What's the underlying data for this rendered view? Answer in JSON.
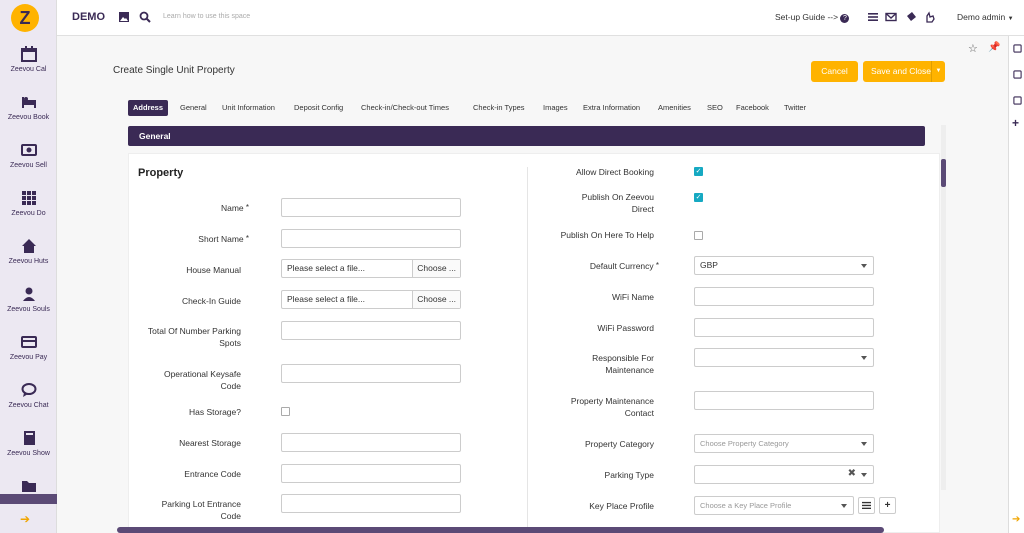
{
  "sidebar": {
    "logo": "Z",
    "items": [
      {
        "label": "Zeevou Cal",
        "icon": "calendar-icon"
      },
      {
        "label": "Zeevou Book",
        "icon": "bed-icon"
      },
      {
        "label": "Zeevou Sell",
        "icon": "money-icon"
      },
      {
        "label": "Zeevou Do",
        "icon": "grid-icon"
      },
      {
        "label": "Zeevou Huts",
        "icon": "home-icon"
      },
      {
        "label": "Zeevou Souls",
        "icon": "user-icon"
      },
      {
        "label": "Zeevou Pay",
        "icon": "credit-card-icon"
      },
      {
        "label": "Zeevou Chat",
        "icon": "chat-icon"
      },
      {
        "label": "Zeevou Show",
        "icon": "book-icon"
      },
      {
        "label": "",
        "icon": "folder-icon"
      }
    ]
  },
  "topbar": {
    "brand": "DEMO",
    "search_placeholder": "Learn how to use this space",
    "setup_guide": "Set-up Guide -->",
    "user": "Demo admin"
  },
  "page": {
    "title": "Create Single Unit Property",
    "cancel": "Cancel",
    "save_close": "Save and Close"
  },
  "tabs": [
    "Address",
    "General",
    "Unit Information",
    "Deposit Config",
    "Check-in/Check-out Times",
    "Check-in Types",
    "Images",
    "Extra Information",
    "Amenities",
    "SEO",
    "Facebook",
    "Twitter"
  ],
  "section": "General",
  "left": {
    "heading": "Property",
    "fields": {
      "name": "Name",
      "short_name": "Short Name",
      "house_manual": "House Manual",
      "checkin_guide": "Check-In Guide",
      "parking_spots_1": "Total Of Number Parking",
      "parking_spots_2": "Spots",
      "keysafe_1": "Operational Keysafe",
      "keysafe_2": "Code",
      "has_storage": "Has Storage?",
      "nearest_storage": "Nearest Storage",
      "entrance_code": "Entrance Code",
      "parking_lot_1": "Parking Lot Entrance",
      "parking_lot_2": "Code"
    },
    "file_placeholder": "Please select a file...",
    "file_button": "Choose ..."
  },
  "right": {
    "fields": {
      "allow_direct": "Allow Direct Booking",
      "publish_zeevou_1": "Publish On Zeevou",
      "publish_zeevou_2": "Direct",
      "publish_here": "Publish On Here To Help",
      "default_currency": "Default Currency",
      "wifi_name": "WiFi Name",
      "wifi_password": "WiFi Password",
      "responsible_1": "Responsible For",
      "responsible_2": "Maintenance",
      "maint_contact_1": "Property Maintenance",
      "maint_contact_2": "Contact",
      "property_category": "Property Category",
      "parking_type": "Parking Type",
      "key_place": "Key Place Profile"
    },
    "currency_value": "GBP",
    "category_placeholder": "Choose Property Category",
    "key_place_placeholder": "Choose a Key Place Profile",
    "allow_direct_checked": true,
    "publish_zeevou_checked": true,
    "publish_here_checked": false
  },
  "colors": {
    "primary": "#3a2a55",
    "accent": "#ffb300",
    "check": "#16a9c2"
  }
}
